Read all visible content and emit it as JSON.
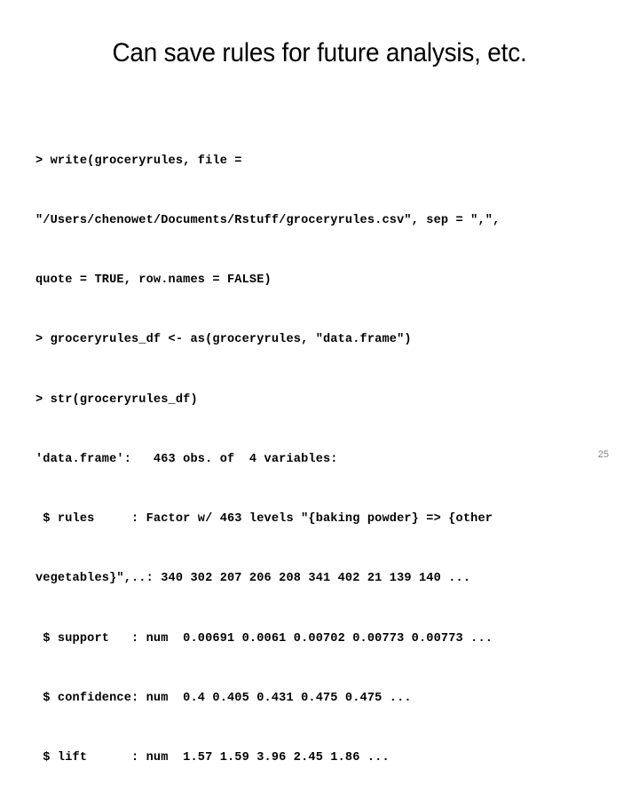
{
  "slide": {
    "title": "Can save rules for future analysis, etc.",
    "page_number": "25",
    "background_color": "#ffffff",
    "text_color": "#000000",
    "page_number_color": "#808080"
  },
  "console": {
    "lines": [
      "> write(groceryrules, file =",
      "\"/Users/chenowet/Documents/Rstuff/groceryrules.csv\", sep = \",\",",
      "quote = TRUE, row.names = FALSE)",
      "> groceryrules_df <- as(groceryrules, \"data.frame\")",
      "> str(groceryrules_df)",
      "'data.frame':   463 obs. of  4 variables:",
      " $ rules     : Factor w/ 463 levels \"{baking powder} => {other",
      "vegetables}\",..: 340 302 207 206 208 341 402 21 139 140 ...",
      " $ support   : num  0.00691 0.0061 0.00702 0.00773 0.00773 ...",
      " $ confidence: num  0.4 0.405 0.431 0.475 0.475 ...",
      " $ lift      : num  1.57 1.59 3.96 2.45 1.86 ..."
    ]
  }
}
